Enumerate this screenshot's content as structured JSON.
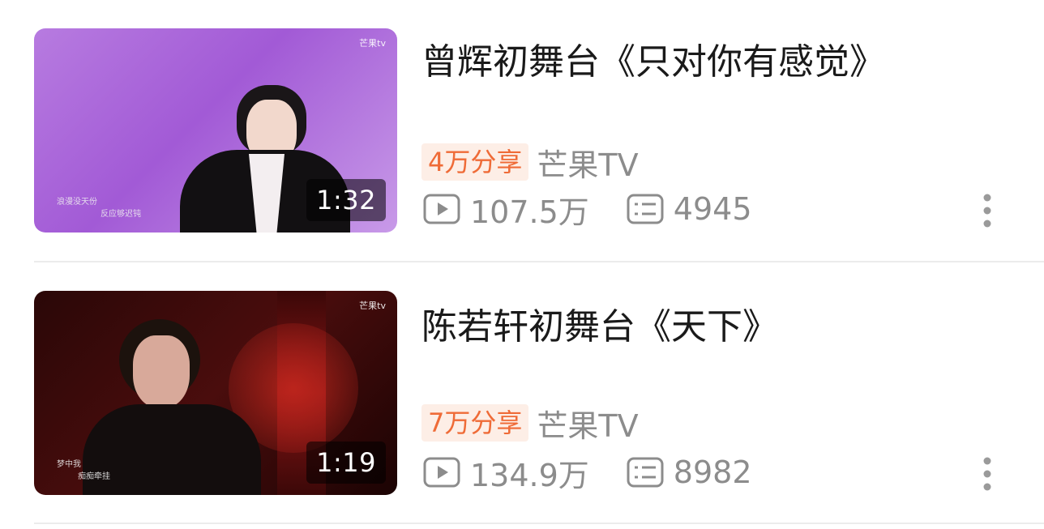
{
  "videos": [
    {
      "title": "曾辉初舞台《只对你有感觉》",
      "duration": "1:32",
      "share": "4万分享",
      "source": "芒果TV",
      "views": "107.5万",
      "comments": "4945",
      "thumbnail": {
        "watermark": "芒果tv",
        "lyric1": "浪漫没天份",
        "lyric2": "反应够迟钝",
        "bg_color": "#a25ad6"
      }
    },
    {
      "title": "陈若轩初舞台《天下》",
      "duration": "1:19",
      "share": "7万分享",
      "source": "芒果TV",
      "views": "134.9万",
      "comments": "8982",
      "thumbnail": {
        "watermark": "芒果tv",
        "lyric1": "梦中我",
        "lyric2": "痴痴牵挂",
        "bg_color": "#4a0d0d"
      }
    }
  ],
  "colors": {
    "share_text": "#ef6b37",
    "share_bg": "#fdeee6",
    "meta_gray": "#8c8c8c"
  },
  "icons": [
    "play-count-icon",
    "comment-icon",
    "more-options-icon"
  ]
}
